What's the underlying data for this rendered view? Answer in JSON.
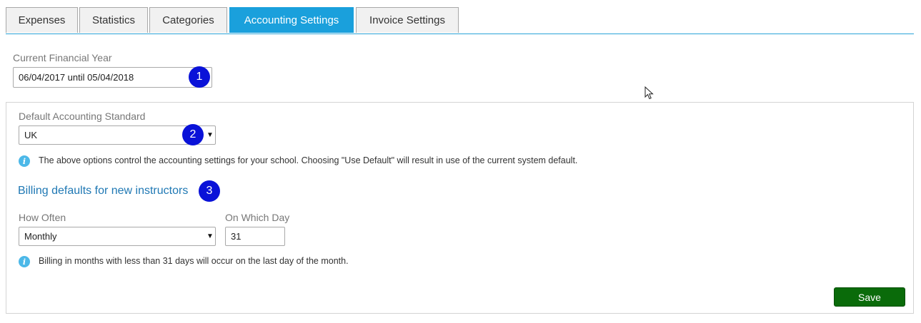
{
  "tabs": [
    {
      "label": "Expenses",
      "active": false
    },
    {
      "label": "Statistics",
      "active": false
    },
    {
      "label": "Categories",
      "active": false
    },
    {
      "label": "Accounting Settings",
      "active": true
    },
    {
      "label": "Invoice Settings",
      "active": false
    }
  ],
  "financial_year": {
    "label": "Current Financial Year",
    "value": "06/04/2017 until 05/04/2018",
    "marker": "1"
  },
  "accounting_standard": {
    "label": "Default Accounting Standard",
    "selected": "UK",
    "marker": "2",
    "info": "The above options control the accounting settings for your school. Choosing \"Use Default\" will result in use of the current system default."
  },
  "billing": {
    "heading": "Billing defaults for new instructors",
    "marker": "3",
    "how_often_label": "How Often",
    "how_often_selected": "Monthly",
    "day_label": "On Which Day",
    "day_value": "31",
    "info": "Billing in months with less than 31 days will occur on the last day of the month."
  },
  "save_label": "Save",
  "icons": {
    "info": "info-icon",
    "dropdown": "chevron-down-icon",
    "cursor": "mouse-pointer-icon"
  },
  "colors": {
    "active_tab": "#1aa0dc",
    "marker": "#0a12d8",
    "heading": "#1f78b4",
    "save_button": "#0a6b0a",
    "info_icon": "#4cb8e8"
  }
}
